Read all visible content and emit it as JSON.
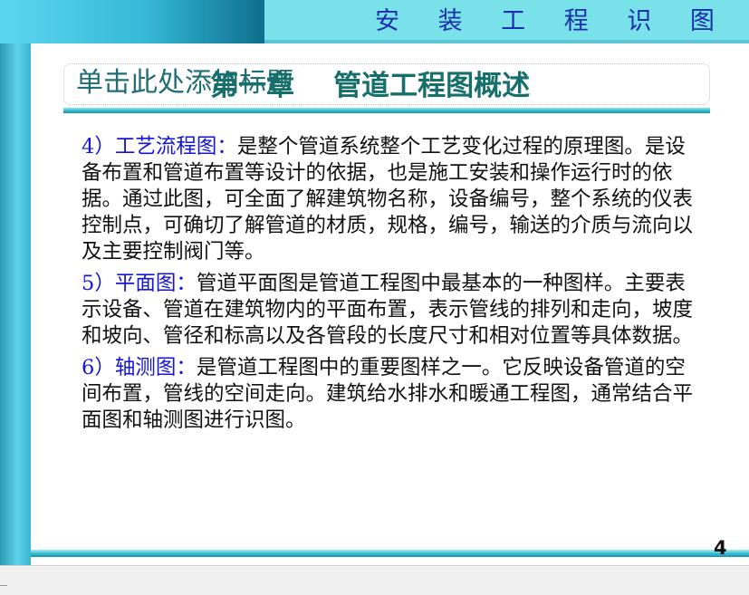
{
  "header": {
    "title": "安 装 工 程 识 图"
  },
  "slide_title": {
    "placeholder": "单击此处添加标题",
    "text": "第一章    管道工程图概述"
  },
  "sections": [
    {
      "label": "4）工艺流程图：",
      "text": "是整个管道系统整个工艺变化过程的原理图。是设备布置和管道布置等设计的依据，也是施工安装和操作运行时的依据。通过此图，可全面了解建筑物名称，设备编号，整个系统的仪表控制点，可确切了解管道的材质，规格，编号，输送的介质与流向以及主要控制阀门等。"
    },
    {
      "label": "5）平面图：",
      "text": "管道平面图是管道工程图中最基本的一种图样。主要表示设备、管道在建筑物内的平面布置，表示管线的排列和走向，坡度和坡向、管径和标高以及各管段的长度尺寸和相对位置等具体数据。"
    },
    {
      "label": "6）轴测图：",
      "text": "是管道工程图中的重要图样之一。它反映设备管道的空间布置，管线的空间走向。建筑给水排水和暖通工程图，通常结合平面图和轴测图进行识图。"
    }
  ],
  "footer": {
    "page_number": "4"
  },
  "colors": {
    "accent_teal": "#33b8cc",
    "label_blue": "#1515d6",
    "header_text": "#1d2fa8",
    "title_green": "#156f6b"
  }
}
